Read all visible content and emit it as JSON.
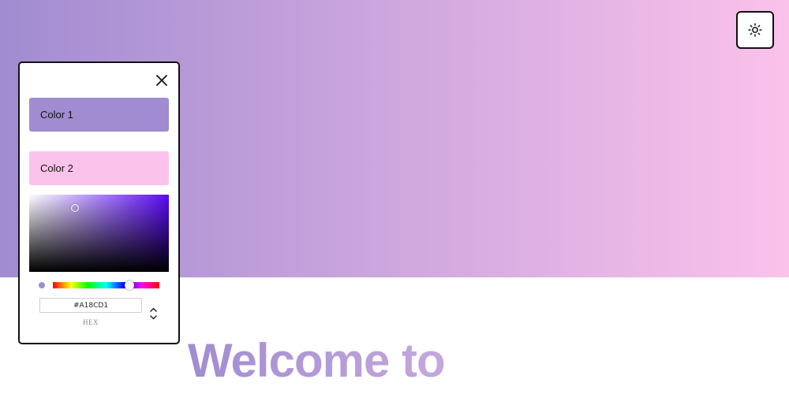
{
  "hero": {
    "gradient_start": "#A18CD1",
    "gradient_end": "#FBC2EB"
  },
  "header": {
    "settings_icon": "sun-icon"
  },
  "main": {
    "heading": "Welcome to"
  },
  "picker": {
    "close_icon": "close-icon",
    "color1": {
      "label": "Color 1",
      "value": "#A18CD1"
    },
    "color2": {
      "label": "Color 2",
      "value": "#FBC2EB"
    },
    "current_hue_color": "#5B0AF8",
    "hex_value": "#A18CD1",
    "hex_label": "HEX",
    "toggle_icon": "chevron-up-down-icon"
  }
}
